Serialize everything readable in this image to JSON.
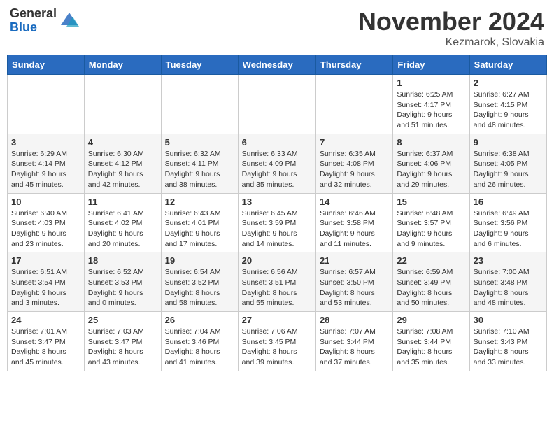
{
  "header": {
    "logo_general": "General",
    "logo_blue": "Blue",
    "month_title": "November 2024",
    "location": "Kezmarok, Slovakia"
  },
  "weekdays": [
    "Sunday",
    "Monday",
    "Tuesday",
    "Wednesday",
    "Thursday",
    "Friday",
    "Saturday"
  ],
  "weeks": [
    [
      {
        "day": "",
        "info": ""
      },
      {
        "day": "",
        "info": ""
      },
      {
        "day": "",
        "info": ""
      },
      {
        "day": "",
        "info": ""
      },
      {
        "day": "",
        "info": ""
      },
      {
        "day": "1",
        "info": "Sunrise: 6:25 AM\nSunset: 4:17 PM\nDaylight: 9 hours\nand 51 minutes."
      },
      {
        "day": "2",
        "info": "Sunrise: 6:27 AM\nSunset: 4:15 PM\nDaylight: 9 hours\nand 48 minutes."
      }
    ],
    [
      {
        "day": "3",
        "info": "Sunrise: 6:29 AM\nSunset: 4:14 PM\nDaylight: 9 hours\nand 45 minutes."
      },
      {
        "day": "4",
        "info": "Sunrise: 6:30 AM\nSunset: 4:12 PM\nDaylight: 9 hours\nand 42 minutes."
      },
      {
        "day": "5",
        "info": "Sunrise: 6:32 AM\nSunset: 4:11 PM\nDaylight: 9 hours\nand 38 minutes."
      },
      {
        "day": "6",
        "info": "Sunrise: 6:33 AM\nSunset: 4:09 PM\nDaylight: 9 hours\nand 35 minutes."
      },
      {
        "day": "7",
        "info": "Sunrise: 6:35 AM\nSunset: 4:08 PM\nDaylight: 9 hours\nand 32 minutes."
      },
      {
        "day": "8",
        "info": "Sunrise: 6:37 AM\nSunset: 4:06 PM\nDaylight: 9 hours\nand 29 minutes."
      },
      {
        "day": "9",
        "info": "Sunrise: 6:38 AM\nSunset: 4:05 PM\nDaylight: 9 hours\nand 26 minutes."
      }
    ],
    [
      {
        "day": "10",
        "info": "Sunrise: 6:40 AM\nSunset: 4:03 PM\nDaylight: 9 hours\nand 23 minutes."
      },
      {
        "day": "11",
        "info": "Sunrise: 6:41 AM\nSunset: 4:02 PM\nDaylight: 9 hours\nand 20 minutes."
      },
      {
        "day": "12",
        "info": "Sunrise: 6:43 AM\nSunset: 4:01 PM\nDaylight: 9 hours\nand 17 minutes."
      },
      {
        "day": "13",
        "info": "Sunrise: 6:45 AM\nSunset: 3:59 PM\nDaylight: 9 hours\nand 14 minutes."
      },
      {
        "day": "14",
        "info": "Sunrise: 6:46 AM\nSunset: 3:58 PM\nDaylight: 9 hours\nand 11 minutes."
      },
      {
        "day": "15",
        "info": "Sunrise: 6:48 AM\nSunset: 3:57 PM\nDaylight: 9 hours\nand 9 minutes."
      },
      {
        "day": "16",
        "info": "Sunrise: 6:49 AM\nSunset: 3:56 PM\nDaylight: 9 hours\nand 6 minutes."
      }
    ],
    [
      {
        "day": "17",
        "info": "Sunrise: 6:51 AM\nSunset: 3:54 PM\nDaylight: 9 hours\nand 3 minutes."
      },
      {
        "day": "18",
        "info": "Sunrise: 6:52 AM\nSunset: 3:53 PM\nDaylight: 9 hours\nand 0 minutes."
      },
      {
        "day": "19",
        "info": "Sunrise: 6:54 AM\nSunset: 3:52 PM\nDaylight: 8 hours\nand 58 minutes."
      },
      {
        "day": "20",
        "info": "Sunrise: 6:56 AM\nSunset: 3:51 PM\nDaylight: 8 hours\nand 55 minutes."
      },
      {
        "day": "21",
        "info": "Sunrise: 6:57 AM\nSunset: 3:50 PM\nDaylight: 8 hours\nand 53 minutes."
      },
      {
        "day": "22",
        "info": "Sunrise: 6:59 AM\nSunset: 3:49 PM\nDaylight: 8 hours\nand 50 minutes."
      },
      {
        "day": "23",
        "info": "Sunrise: 7:00 AM\nSunset: 3:48 PM\nDaylight: 8 hours\nand 48 minutes."
      }
    ],
    [
      {
        "day": "24",
        "info": "Sunrise: 7:01 AM\nSunset: 3:47 PM\nDaylight: 8 hours\nand 45 minutes."
      },
      {
        "day": "25",
        "info": "Sunrise: 7:03 AM\nSunset: 3:47 PM\nDaylight: 8 hours\nand 43 minutes."
      },
      {
        "day": "26",
        "info": "Sunrise: 7:04 AM\nSunset: 3:46 PM\nDaylight: 8 hours\nand 41 minutes."
      },
      {
        "day": "27",
        "info": "Sunrise: 7:06 AM\nSunset: 3:45 PM\nDaylight: 8 hours\nand 39 minutes."
      },
      {
        "day": "28",
        "info": "Sunrise: 7:07 AM\nSunset: 3:44 PM\nDaylight: 8 hours\nand 37 minutes."
      },
      {
        "day": "29",
        "info": "Sunrise: 7:08 AM\nSunset: 3:44 PM\nDaylight: 8 hours\nand 35 minutes."
      },
      {
        "day": "30",
        "info": "Sunrise: 7:10 AM\nSunset: 3:43 PM\nDaylight: 8 hours\nand 33 minutes."
      }
    ]
  ]
}
